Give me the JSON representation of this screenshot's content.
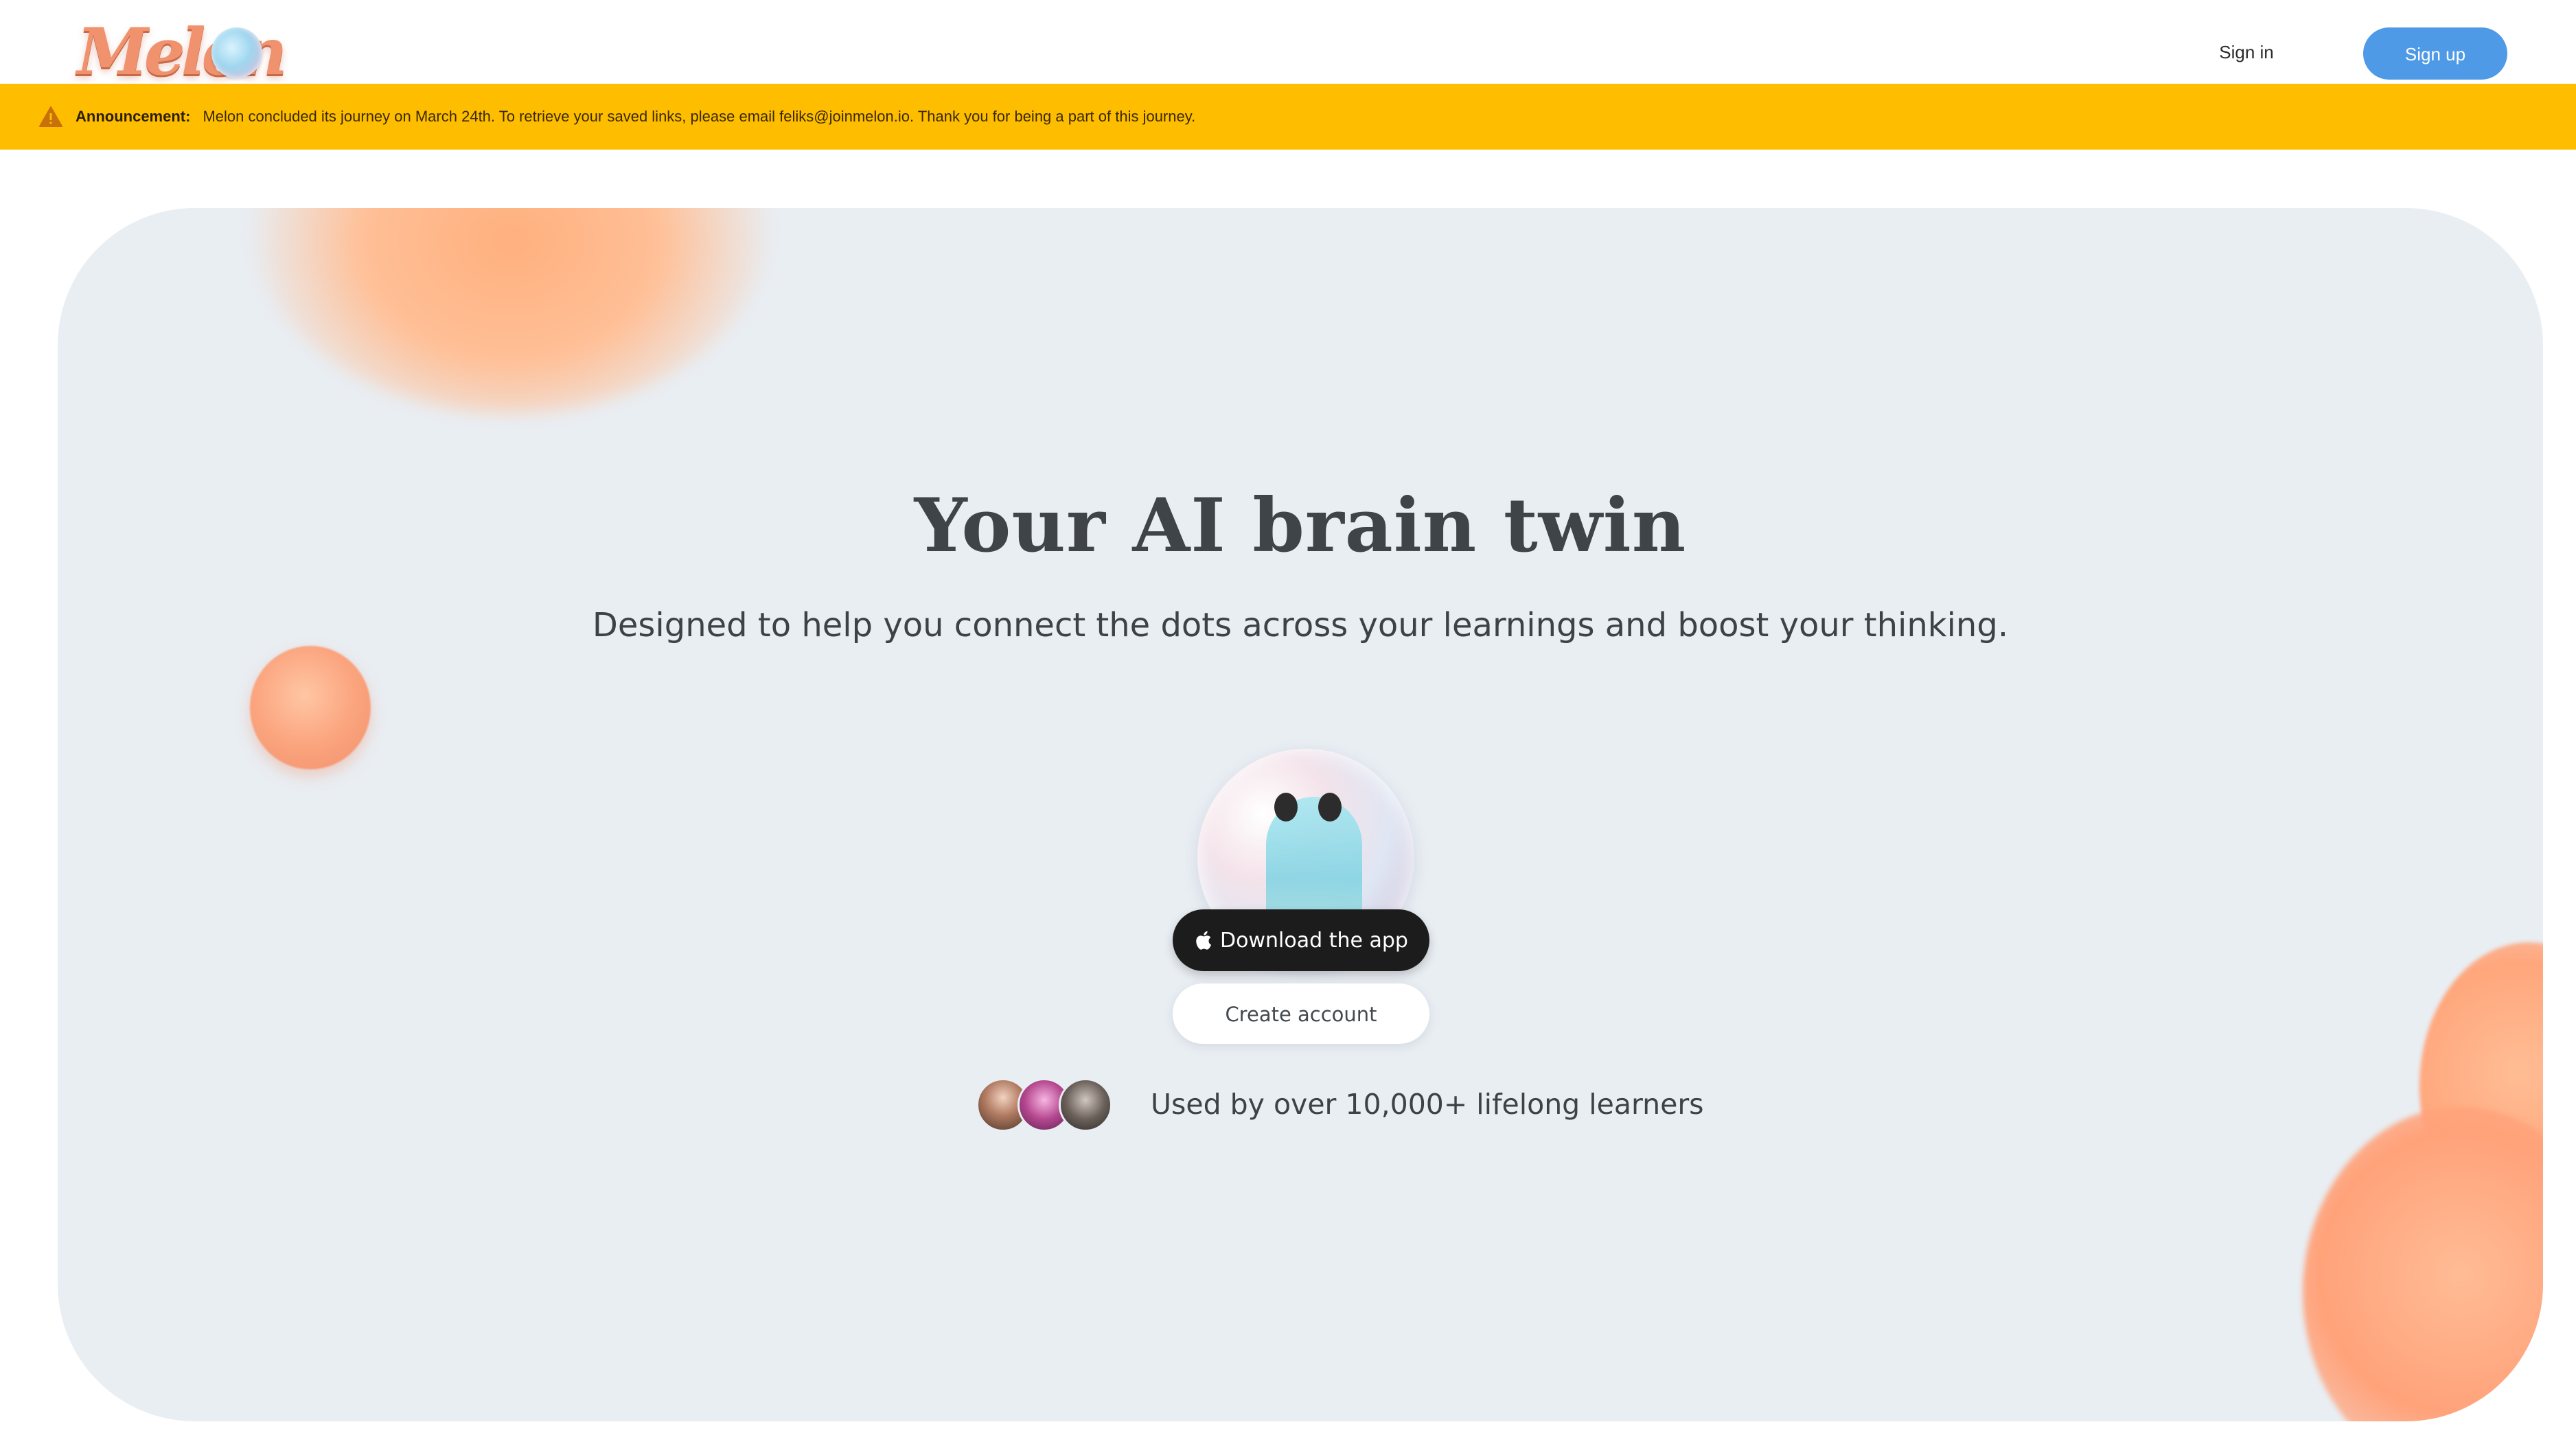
{
  "header": {
    "logo_text": "Melon",
    "signin_label": "Sign in",
    "signup_label": "Sign up"
  },
  "announcement": {
    "label": "Announcement:",
    "message": "Melon concluded its journey on March 24th. To retrieve your saved links, please email feliks@joinmelon.io. Thank you for being a part of this journey.",
    "icon": "warning-icon",
    "background": "#ffbd00"
  },
  "hero": {
    "title": "Your AI brain twin",
    "subtitle": "Designed to help you connect the dots across your learnings and boost your thinking.",
    "download_label": "Download the app",
    "download_icon": "apple-icon",
    "create_label": "Create account",
    "social_proof": "Used by over 10,000+ lifelong learners"
  },
  "colors": {
    "accent": "#4f9ae6",
    "banner": "#ffbd00",
    "hero_bg": "#e9eef3",
    "blob": "#ffa77e",
    "primary_button": "#1c1c1c"
  }
}
